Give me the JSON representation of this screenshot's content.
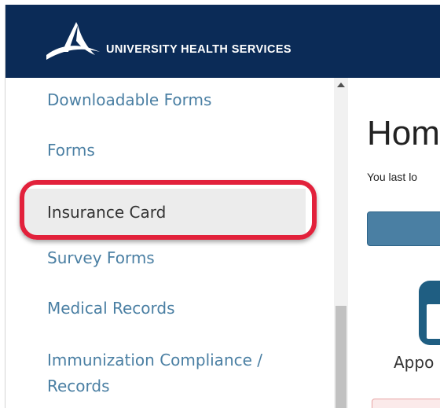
{
  "header": {
    "brand_text": "UNIVERSITY HEALTH SERVICES"
  },
  "sidebar": {
    "items": [
      {
        "label": "Downloadable Forms",
        "active": false
      },
      {
        "label": "Forms",
        "active": false
      },
      {
        "label": "Insurance Card",
        "active": true
      },
      {
        "label": "Survey Forms",
        "active": false
      },
      {
        "label": "Medical Records",
        "active": false
      },
      {
        "label": "Immunization Compliance / Records",
        "active": false
      }
    ]
  },
  "main": {
    "title": "Hom",
    "last_login": "You last lo",
    "appointments_label": "Appo"
  },
  "colors": {
    "header_bg": "#0b2b57",
    "link": "#4a7fa3",
    "highlight": "#e2213b",
    "active_bg": "#ececec"
  }
}
